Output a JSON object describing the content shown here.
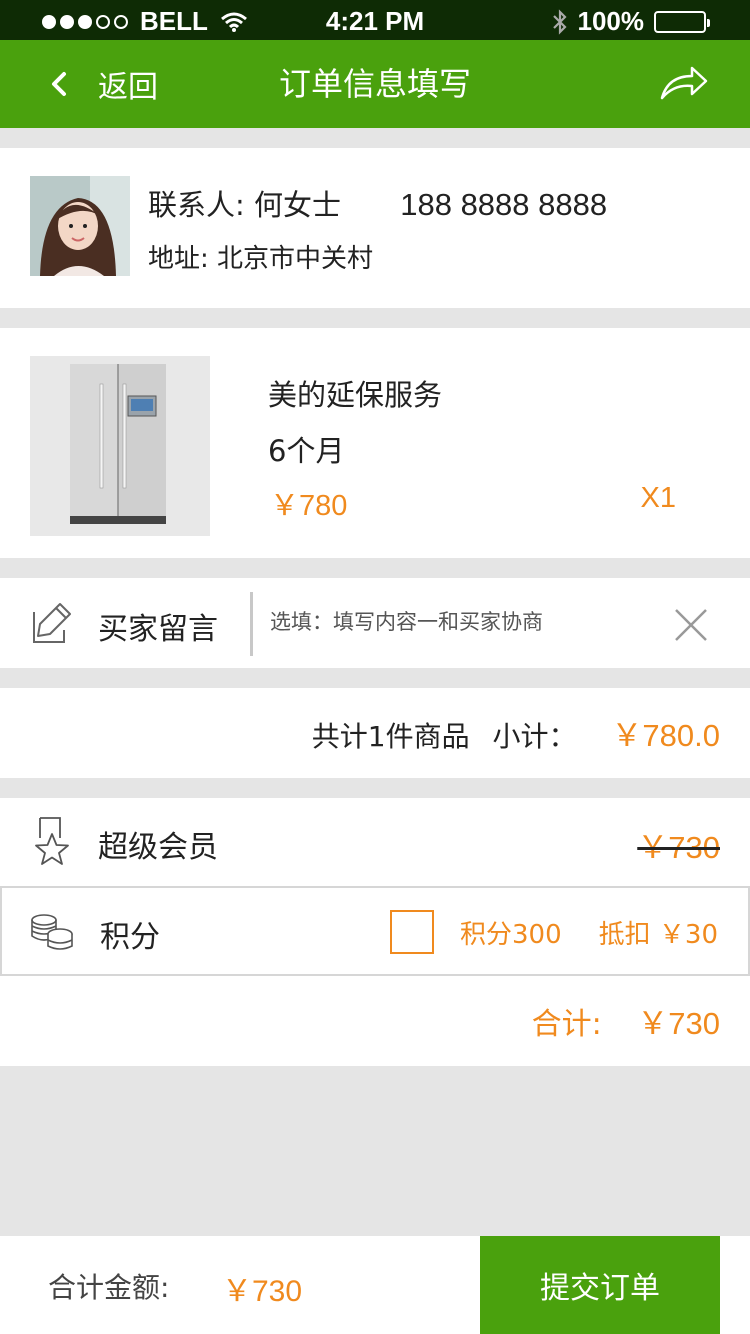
{
  "status_bar": {
    "carrier": "BELL",
    "time": "4:21 PM",
    "battery": "100%"
  },
  "nav": {
    "back_label": "返回",
    "title": "订单信息填写",
    "share_icon": "share-arrow-icon"
  },
  "contact": {
    "label": "联系人:",
    "name": "何女士",
    "phone": "188 8888 8888",
    "address_label": "地址:",
    "address": "北京市中关村"
  },
  "product": {
    "name": "美的延保服务",
    "spec": "6个月",
    "price": "￥780",
    "quantity": "X1"
  },
  "message": {
    "label": "买家留言",
    "placeholder": "选填：填写内容一和买家协商"
  },
  "subtotal": {
    "count_text": "共计1件商品",
    "label": "小计：",
    "price": "￥780.0"
  },
  "member": {
    "label": "超级会员",
    "original_price": "￥730"
  },
  "points": {
    "label": "积分",
    "count": "积分300",
    "deduct": "抵扣 ￥30",
    "checked": false
  },
  "total": {
    "label": "合计:",
    "amount": "￥730"
  },
  "footer": {
    "label": "合计金额:",
    "amount": "￥730",
    "submit_label": "提交订单"
  },
  "colors": {
    "brand_green": "#4aa10d",
    "accent_orange": "#f08a1e",
    "background": "#e5e5e5"
  }
}
